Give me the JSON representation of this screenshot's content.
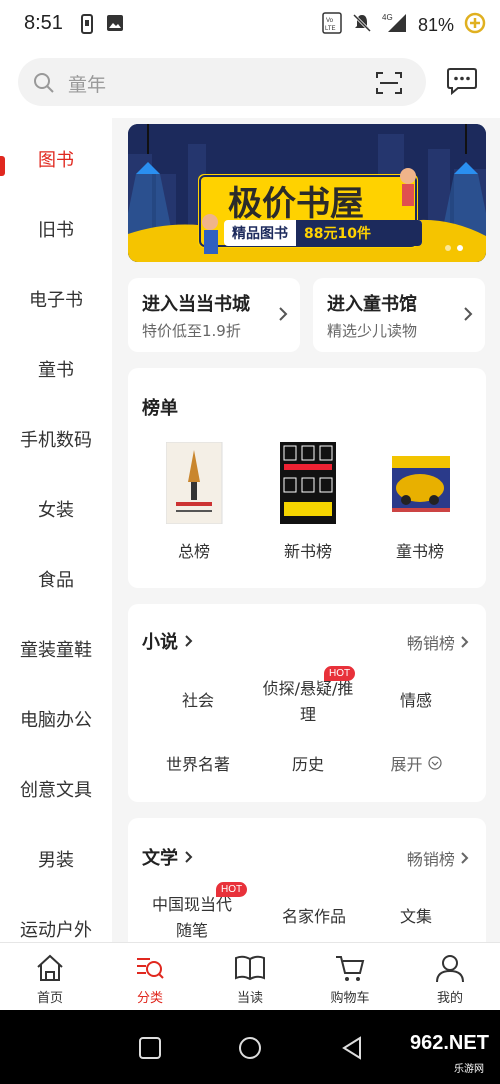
{
  "status_bar": {
    "time": "8:51",
    "battery": "81%",
    "network": "4G"
  },
  "search": {
    "placeholder": "童年"
  },
  "sidebar": {
    "items": [
      {
        "label": "图书",
        "active": true
      },
      {
        "label": "旧书"
      },
      {
        "label": "电子书"
      },
      {
        "label": "童书"
      },
      {
        "label": "手机数码"
      },
      {
        "label": "女装"
      },
      {
        "label": "食品"
      },
      {
        "label": "童装童鞋"
      },
      {
        "label": "电脑办公"
      },
      {
        "label": "创意文具"
      },
      {
        "label": "男装"
      },
      {
        "label": "运动户外"
      }
    ]
  },
  "banner": {
    "title": "极价书屋",
    "sub_left": "精品图书",
    "sub_right": "88元10件"
  },
  "entries": [
    {
      "title": "进入当当书城",
      "subtitle": "特价低至1.9折"
    },
    {
      "title": "进入童书馆",
      "subtitle": "精选少儿读物"
    }
  ],
  "ranking": {
    "title": "榜单",
    "items": [
      {
        "label": "总榜"
      },
      {
        "label": "新书榜"
      },
      {
        "label": "童书榜"
      }
    ]
  },
  "novel": {
    "title": "小说",
    "more": "畅销榜",
    "tags": [
      "社会",
      "侦探/悬疑/推理",
      "情感",
      "世界名著",
      "历史",
      "展开"
    ],
    "hot_badge": "HOT"
  },
  "literature": {
    "title": "文学",
    "more": "畅销榜",
    "tags": [
      "中国现当代随笔",
      "名家作品",
      "文集"
    ],
    "hot_badge": "HOT"
  },
  "bottom_nav": {
    "items": [
      {
        "label": "首页"
      },
      {
        "label": "分类",
        "active": true
      },
      {
        "label": "当读"
      },
      {
        "label": "购物车"
      },
      {
        "label": "我的"
      }
    ]
  },
  "watermark": {
    "text": "962.NET",
    "sub": "乐游网"
  },
  "colors": {
    "accent": "#e0281f",
    "hot": "#e8313a",
    "banner_bg": "#1c2a5c",
    "banner_yellow": "#ffd200"
  }
}
